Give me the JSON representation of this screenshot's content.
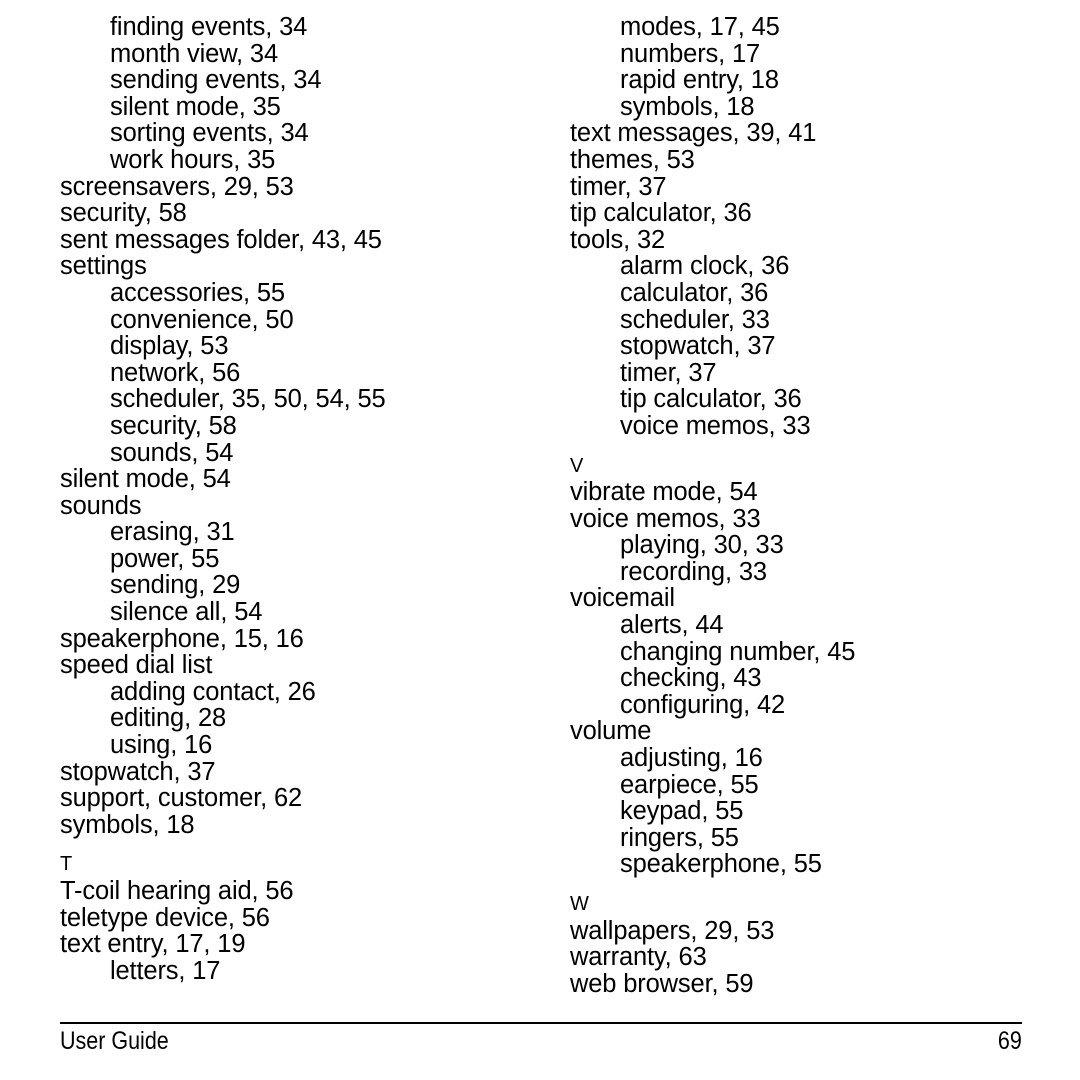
{
  "document": {
    "type": "index",
    "page_number": "69",
    "footer_label": "User Guide"
  },
  "columns": [
    {
      "name": "left-column",
      "lines": [
        {
          "kind": "entry",
          "level": 2,
          "text": "finding events, 34"
        },
        {
          "kind": "entry",
          "level": 2,
          "text": "month view, 34"
        },
        {
          "kind": "entry",
          "level": 2,
          "text": "sending events, 34"
        },
        {
          "kind": "entry",
          "level": 2,
          "text": "silent mode, 35"
        },
        {
          "kind": "entry",
          "level": 2,
          "text": "sorting events, 34"
        },
        {
          "kind": "entry",
          "level": 2,
          "text": "work hours, 35"
        },
        {
          "kind": "entry",
          "level": 1,
          "text": "screensavers, 29, 53"
        },
        {
          "kind": "entry",
          "level": 1,
          "text": "security, 58"
        },
        {
          "kind": "entry",
          "level": 1,
          "text": "sent messages folder, 43, 45"
        },
        {
          "kind": "entry",
          "level": 1,
          "text": "settings"
        },
        {
          "kind": "entry",
          "level": 2,
          "text": "accessories, 55"
        },
        {
          "kind": "entry",
          "level": 2,
          "text": "convenience, 50"
        },
        {
          "kind": "entry",
          "level": 2,
          "text": "display, 53"
        },
        {
          "kind": "entry",
          "level": 2,
          "text": "network, 56"
        },
        {
          "kind": "entry",
          "level": 2,
          "text": "scheduler, 35, 50, 54, 55"
        },
        {
          "kind": "entry",
          "level": 2,
          "text": "security, 58"
        },
        {
          "kind": "entry",
          "level": 2,
          "text": "sounds, 54"
        },
        {
          "kind": "entry",
          "level": 1,
          "text": "silent mode, 54"
        },
        {
          "kind": "entry",
          "level": 1,
          "text": "sounds"
        },
        {
          "kind": "entry",
          "level": 2,
          "text": "erasing, 31"
        },
        {
          "kind": "entry",
          "level": 2,
          "text": "power, 55"
        },
        {
          "kind": "entry",
          "level": 2,
          "text": "sending, 29"
        },
        {
          "kind": "entry",
          "level": 2,
          "text": "silence all, 54"
        },
        {
          "kind": "entry",
          "level": 1,
          "text": "speakerphone, 15, 16"
        },
        {
          "kind": "entry",
          "level": 1,
          "text": "speed dial list"
        },
        {
          "kind": "entry",
          "level": 2,
          "text": "adding contact, 26"
        },
        {
          "kind": "entry",
          "level": 2,
          "text": "editing, 28"
        },
        {
          "kind": "entry",
          "level": 2,
          "text": "using, 16"
        },
        {
          "kind": "entry",
          "level": 1,
          "text": "stopwatch, 37"
        },
        {
          "kind": "entry",
          "level": 1,
          "text": "support, customer, 62"
        },
        {
          "kind": "entry",
          "level": 1,
          "text": "symbols, 18"
        },
        {
          "kind": "gap"
        },
        {
          "kind": "letter",
          "text": "T"
        },
        {
          "kind": "entry",
          "level": 1,
          "text": "T-coil hearing aid, 56"
        },
        {
          "kind": "entry",
          "level": 1,
          "text": "teletype device, 56"
        },
        {
          "kind": "entry",
          "level": 1,
          "text": "text entry, 17, 19"
        },
        {
          "kind": "entry",
          "level": 2,
          "text": "letters, 17"
        }
      ]
    },
    {
      "name": "right-column",
      "lines": [
        {
          "kind": "entry",
          "level": 2,
          "text": "modes, 17, 45"
        },
        {
          "kind": "entry",
          "level": 2,
          "text": "numbers, 17"
        },
        {
          "kind": "entry",
          "level": 2,
          "text": "rapid entry, 18"
        },
        {
          "kind": "entry",
          "level": 2,
          "text": "symbols, 18"
        },
        {
          "kind": "entry",
          "level": 1,
          "text": "text messages, 39, 41"
        },
        {
          "kind": "entry",
          "level": 1,
          "text": "themes, 53"
        },
        {
          "kind": "entry",
          "level": 1,
          "text": "timer, 37"
        },
        {
          "kind": "entry",
          "level": 1,
          "text": "tip calculator, 36"
        },
        {
          "kind": "entry",
          "level": 1,
          "text": "tools, 32"
        },
        {
          "kind": "entry",
          "level": 2,
          "text": "alarm clock, 36"
        },
        {
          "kind": "entry",
          "level": 2,
          "text": "calculator, 36"
        },
        {
          "kind": "entry",
          "level": 2,
          "text": "scheduler, 33"
        },
        {
          "kind": "entry",
          "level": 2,
          "text": "stopwatch, 37"
        },
        {
          "kind": "entry",
          "level": 2,
          "text": "timer, 37"
        },
        {
          "kind": "entry",
          "level": 2,
          "text": "tip calculator, 36"
        },
        {
          "kind": "entry",
          "level": 2,
          "text": "voice memos, 33"
        },
        {
          "kind": "gap"
        },
        {
          "kind": "letter",
          "text": "V"
        },
        {
          "kind": "entry",
          "level": 1,
          "text": "vibrate mode, 54"
        },
        {
          "kind": "entry",
          "level": 1,
          "text": "voice memos, 33"
        },
        {
          "kind": "entry",
          "level": 2,
          "text": "playing, 30, 33"
        },
        {
          "kind": "entry",
          "level": 2,
          "text": "recording, 33"
        },
        {
          "kind": "entry",
          "level": 1,
          "text": "voicemail"
        },
        {
          "kind": "entry",
          "level": 2,
          "text": "alerts, 44"
        },
        {
          "kind": "entry",
          "level": 2,
          "text": "changing number, 45"
        },
        {
          "kind": "entry",
          "level": 2,
          "text": "checking, 43"
        },
        {
          "kind": "entry",
          "level": 2,
          "text": "configuring, 42"
        },
        {
          "kind": "entry",
          "level": 1,
          "text": "volume"
        },
        {
          "kind": "entry",
          "level": 2,
          "text": "adjusting, 16"
        },
        {
          "kind": "entry",
          "level": 2,
          "text": "earpiece, 55"
        },
        {
          "kind": "entry",
          "level": 2,
          "text": "keypad, 55"
        },
        {
          "kind": "entry",
          "level": 2,
          "text": "ringers, 55"
        },
        {
          "kind": "entry",
          "level": 2,
          "text": "speakerphone, 55"
        },
        {
          "kind": "gap"
        },
        {
          "kind": "letter",
          "text": "W"
        },
        {
          "kind": "entry",
          "level": 1,
          "text": "wallpapers, 29, 53"
        },
        {
          "kind": "entry",
          "level": 1,
          "text": "warranty, 63"
        },
        {
          "kind": "entry",
          "level": 1,
          "text": "web browser, 59"
        }
      ]
    }
  ]
}
